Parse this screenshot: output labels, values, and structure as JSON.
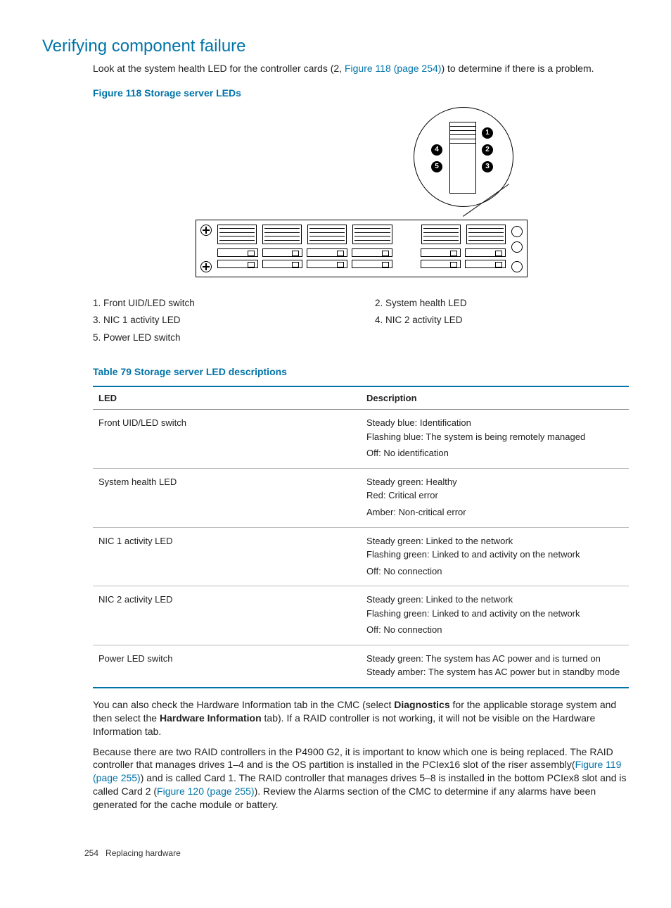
{
  "section": {
    "title": "Verifying component failure",
    "intro_pre": "Look at the system health LED for the controller cards (2, ",
    "intro_link": "Figure 118 (page 254)",
    "intro_post": ") to determine if there is a problem."
  },
  "figure": {
    "caption": "Figure 118 Storage server LEDs",
    "callouts": [
      "1",
      "2",
      "3",
      "4",
      "5"
    ],
    "legend": [
      "1. Front UID/LED switch",
      "2. System health LED",
      "3. NIC 1 activity LED",
      "4. NIC 2 activity LED",
      "5. Power LED switch"
    ]
  },
  "table": {
    "caption": "Table 79 Storage server LED descriptions",
    "headers": [
      "LED",
      "Description"
    ],
    "rows": [
      {
        "led": "Front UID/LED switch",
        "desc": [
          "Steady blue: Identification",
          "Flashing blue: The system is being remotely managed",
          "Off: No identification"
        ]
      },
      {
        "led": "System health LED",
        "desc": [
          "Steady green: Healthy",
          "Red: Critical error",
          "Amber: Non-critical error"
        ]
      },
      {
        "led": "NIC 1 activity LED",
        "desc": [
          "Steady green: Linked to the network",
          "Flashing green: Linked to and activity on the network",
          "Off: No connection"
        ]
      },
      {
        "led": "NIC 2 activity LED",
        "desc": [
          "Steady green: Linked to the network",
          "Flashing green: Linked to and activity on the network",
          "Off: No connection"
        ]
      },
      {
        "led": "Power LED switch",
        "desc": [
          "Steady green: The system has AC power and is turned on",
          "Steady amber: The system has AC power but in standby mode"
        ]
      }
    ]
  },
  "body": {
    "p1_a": "You can also check the Hardware Information tab in the CMC (select ",
    "p1_b": "Diagnostics",
    "p1_c": " for the applicable storage system and then select the ",
    "p1_d": "Hardware Information",
    "p1_e": " tab). If a RAID controller is not working, it will not be visible on the Hardware Information tab.",
    "p2_a": "Because there are two RAID controllers in the P4900 G2, it is important to know which one is being replaced. The RAID controller that manages drives 1–4 and is the OS partition is installed in the PCIex16 slot of the riser assembly(",
    "p2_link1": "Figure 119 (page 255)",
    "p2_b": ") and is called Card 1. The RAID controller that manages drives 5–8 is installed in the bottom PCIex8 slot and is called Card 2 (",
    "p2_link2": "Figure 120 (page 255)",
    "p2_c": "). Review the Alarms section of the CMC to determine if any alarms have been generated for the cache module or battery."
  },
  "footer": {
    "page": "254",
    "chapter": "Replacing hardware"
  }
}
